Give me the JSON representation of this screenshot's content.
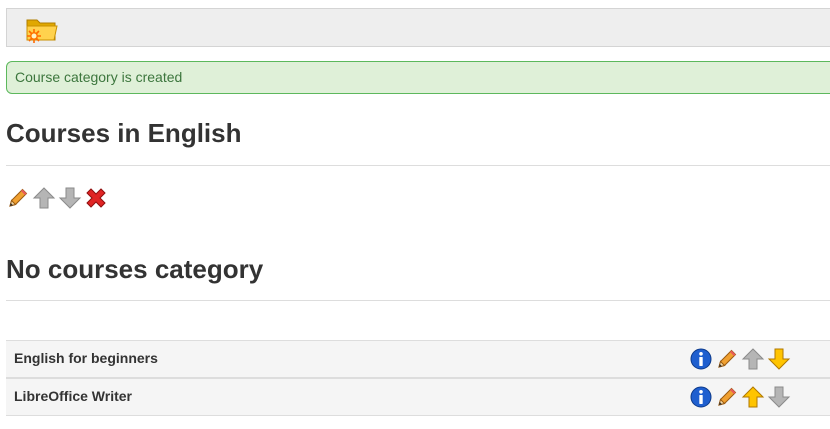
{
  "toolbar": {
    "add_category_icon": "folder-add-icon"
  },
  "alert": {
    "message": "Course category is created",
    "color": "#3c763d",
    "background": "#dff0d8",
    "border": "#5cb85c"
  },
  "category": {
    "title": "Courses in English",
    "actions": [
      "edit-icon",
      "move-up-icon",
      "move-down-icon",
      "delete-icon"
    ]
  },
  "no_category": {
    "title": "No courses category"
  },
  "courses": [
    {
      "name": "English for beginners",
      "actions": [
        "info-icon",
        "edit-icon",
        "move-up-icon-disabled",
        "move-down-icon"
      ]
    },
    {
      "name": "LibreOffice Writer",
      "actions": [
        "info-icon",
        "edit-icon",
        "move-up-icon",
        "move-down-icon-disabled"
      ]
    }
  ]
}
